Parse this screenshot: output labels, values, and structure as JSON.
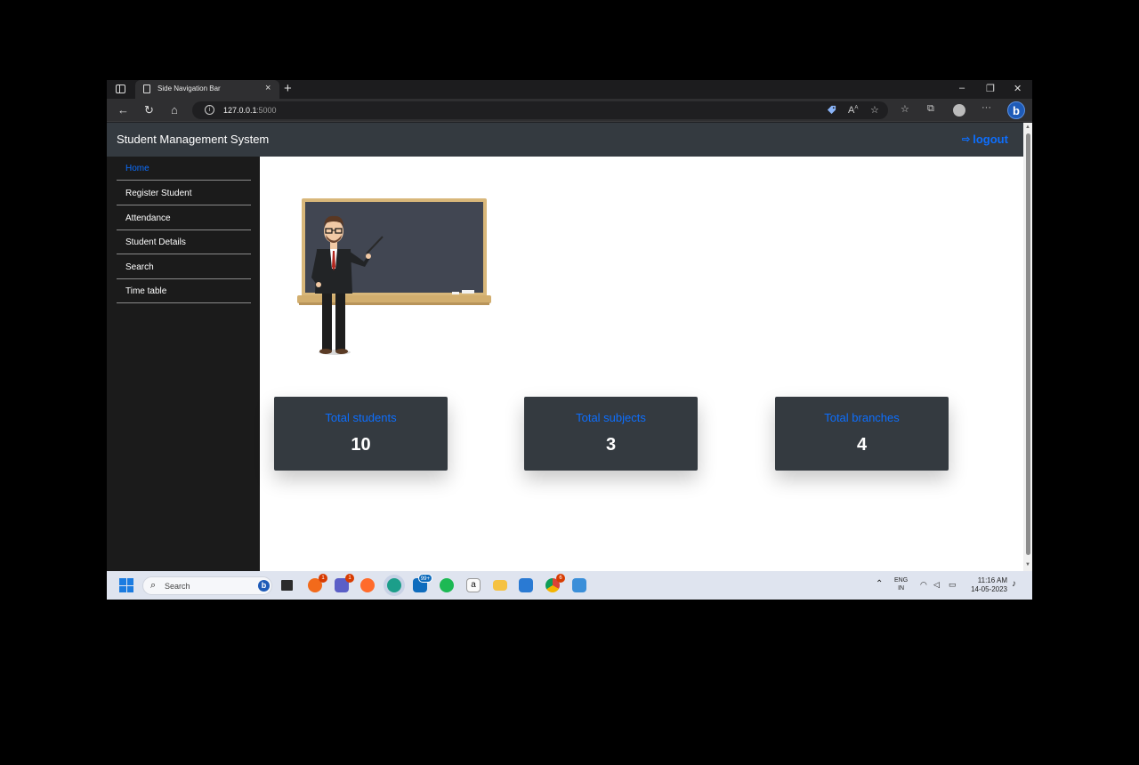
{
  "browser": {
    "tab_title": "Side Navigation Bar",
    "tab_close": "×",
    "new_tab": "+",
    "url_host": "127.0.0.1",
    "url_port": ":5000",
    "window_controls": {
      "minimize": "–",
      "restore": "❐",
      "close": "✕"
    },
    "nav_icons": {
      "back": "←",
      "reload": "↻",
      "home": "⌂"
    },
    "toolbar_icons": [
      "tag-icon",
      "read-aloud-icon",
      "add-favorite-icon",
      "favorites-icon",
      "collections-icon",
      "profile-icon",
      "more-icon",
      "bing-icon"
    ],
    "more_label": "···",
    "bing_letter": "b"
  },
  "app": {
    "title": "Student Management System",
    "logout_label": "logout",
    "accent_color": "#0d6efd",
    "navbar_color": "#343a40"
  },
  "sidebar": {
    "items": [
      {
        "label": "Home",
        "active": true
      },
      {
        "label": "Register Student"
      },
      {
        "label": "Attendance"
      },
      {
        "label": "Student Details"
      },
      {
        "label": "Search"
      },
      {
        "label": "Time table"
      }
    ]
  },
  "stats": [
    {
      "label": "Total students",
      "value": "10"
    },
    {
      "label": "Total subjects",
      "value": "3"
    },
    {
      "label": "Total branches",
      "value": "4"
    }
  ],
  "taskbar": {
    "search_placeholder": "Search",
    "apps": [
      "file-explorer-view-icon",
      "brave-icon",
      "teams-icon",
      "firefox-icon",
      "edge-icon",
      "mail-icon",
      "spotify-icon",
      "amazon-icon",
      "folder-icon",
      "vscode-icon",
      "chrome-icon",
      "photos-icon"
    ],
    "badges": {
      "brave": "1",
      "teams": "1",
      "mail": "99+",
      "chrome": "6"
    },
    "lang_line1": "ENG",
    "lang_line2": "IN",
    "time": "11:16 AM",
    "date": "14-05-2023"
  }
}
